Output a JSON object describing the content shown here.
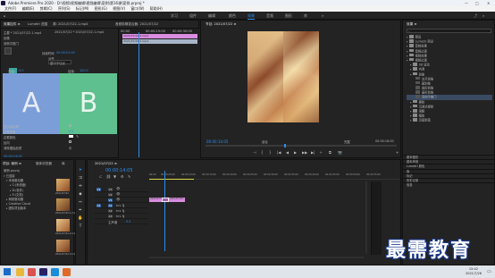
{
  "window": {
    "title": "Adobe Premiere Pro 2020 - D:\\视频\\视频编辑\\视频编辑\\案例\\第16课\\案例.prproj *"
  },
  "menu": [
    "文件(F)",
    "编辑(E)",
    "剪辑(C)",
    "序列(S)",
    "标记(M)",
    "图形(G)",
    "视图(V)",
    "窗口(W)",
    "帮助(H)"
  ],
  "workspaces": [
    "学习",
    "组件",
    "编辑",
    "颜色",
    "效果",
    "音频",
    "图形",
    "库"
  ],
  "effect_controls": {
    "tabs": [
      "效果控件 ≡",
      "Lumetri 范围",
      "源: 2021/07/22-1.mp4",
      "音频剪辑混合器: 2021/07/22"
    ],
    "source_label": "主要 * 2021/07/22-1.mp4",
    "clip_label": "2021/07/22 * 2021/07/22-1.mp4",
    "group": "划像",
    "effect_name": "双侧平推门",
    "duration_label": "持续时间",
    "duration_value": "00:00:01:00",
    "align_label": "对齐",
    "align_value": "居中于切点",
    "start_label": "开始:",
    "start_value": "0.0",
    "end_label": "结束:",
    "end_value": "100.0",
    "preview_a": "A",
    "preview_b": "B",
    "props": [
      "显示实际源",
      "边框宽度",
      "边框颜色",
      "反向",
      "消除锯齿品质"
    ],
    "prop_values": [
      "",
      "0.0",
      "",
      "",
      "中"
    ],
    "timecode": "00:00:14:00"
  },
  "mini_timeline": {
    "clip1": "2021/07/22-2.mp4",
    "clip2": "2021/07/22-1.mp4",
    "ruler": [
      "00:00",
      "00:00:15:00",
      "00:00:30:00"
    ]
  },
  "program": {
    "tab": "节目: 2021/07/22 ≡",
    "timecode": "00:00:14:05",
    "fit": "适合",
    "full": "完整",
    "duration": "00:00:16:00",
    "transport": [
      "⊣",
      "{",
      "}",
      "|◀",
      "◀◀",
      "◀",
      "▶",
      "▶▶",
      "▶|",
      "⊢",
      "⧉",
      "📷",
      "+"
    ]
  },
  "effects": {
    "title": "效果 ≡",
    "search": "",
    "items": [
      "预设",
      "Lumetri 预设",
      "音频效果",
      "音频过渡",
      "视频效果",
      "视频过渡",
      "3D 运动",
      "内滑",
      "划像",
      "交叉划像",
      "圆划像",
      "盒形划像",
      "菱形划像",
      "双侧平推门",
      "擦除",
      "沉浸式视频",
      "溶解",
      "缩放",
      "页面剥落"
    ],
    "extra": [
      "基本图形",
      "基本声音",
      "Lumetri 颜色",
      "库",
      "标记",
      "历史记录",
      "信息"
    ]
  },
  "project": {
    "tabs": [
      "项目: 案例 ≡",
      "媒体浏览器",
      "库"
    ],
    "folder": "案例.prproj",
    "tree": [
      "已连接",
      "本地驱动器",
      "C:(系统盘)",
      "D:(软件)",
      "E:(文档)",
      "网络驱动器",
      "Creative Cloud",
      "团队项目版本"
    ],
    "thumbs": [
      "2021/07/22",
      "2021/07/22-1.mp4",
      "2021/07/22-2.mp4",
      "2021/07/22-3.mp4"
    ]
  },
  "timeline": {
    "tab": "2021/07/22 ≡",
    "timecode": "00:00:14:05",
    "ruler": [
      "00:00",
      "00:00:05:00",
      "00:00:10:00",
      "00:00:15:00",
      "00:00:20:00",
      "00:00:25:00",
      "00:00:30:00",
      "00:00:35:00",
      "00:00:40:00",
      "00:00:45:00",
      "00:00:50:00",
      "00:00:55:00",
      "00:01:00:00"
    ],
    "tracks": [
      "V3",
      "V2",
      "V1",
      "A1",
      "A2",
      "A3",
      "主声道"
    ],
    "master_value": "0.0",
    "clip_v1": "2021/07/22-1",
    "clip_v1b": "2021/07/22-2"
  },
  "taskbar": {
    "time": "15:42",
    "date": "2021/7/26"
  },
  "watermark": "最需教育",
  "colors": {
    "accent": "#2d8ceb",
    "clip": "#d98ce0",
    "panel": "#232323",
    "preview_a": "#7b9ed8",
    "preview_b": "#5ec08e"
  }
}
